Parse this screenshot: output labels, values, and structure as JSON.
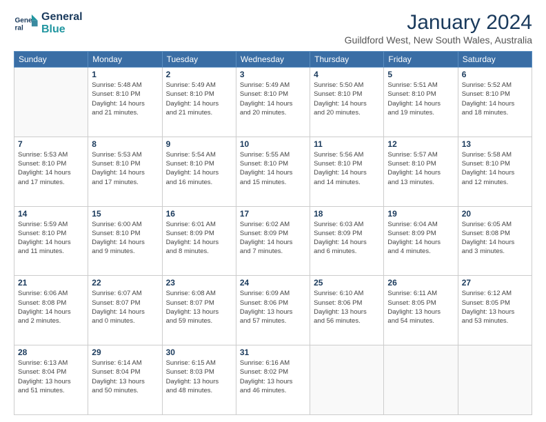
{
  "logo": {
    "line1": "General",
    "line2": "Blue"
  },
  "title": "January 2024",
  "subtitle": "Guildford West, New South Wales, Australia",
  "weekdays": [
    "Sunday",
    "Monday",
    "Tuesday",
    "Wednesday",
    "Thursday",
    "Friday",
    "Saturday"
  ],
  "weeks": [
    [
      {
        "day": "",
        "info": ""
      },
      {
        "day": "1",
        "info": "Sunrise: 5:48 AM\nSunset: 8:10 PM\nDaylight: 14 hours\nand 21 minutes."
      },
      {
        "day": "2",
        "info": "Sunrise: 5:49 AM\nSunset: 8:10 PM\nDaylight: 14 hours\nand 21 minutes."
      },
      {
        "day": "3",
        "info": "Sunrise: 5:49 AM\nSunset: 8:10 PM\nDaylight: 14 hours\nand 20 minutes."
      },
      {
        "day": "4",
        "info": "Sunrise: 5:50 AM\nSunset: 8:10 PM\nDaylight: 14 hours\nand 20 minutes."
      },
      {
        "day": "5",
        "info": "Sunrise: 5:51 AM\nSunset: 8:10 PM\nDaylight: 14 hours\nand 19 minutes."
      },
      {
        "day": "6",
        "info": "Sunrise: 5:52 AM\nSunset: 8:10 PM\nDaylight: 14 hours\nand 18 minutes."
      }
    ],
    [
      {
        "day": "7",
        "info": "Sunrise: 5:53 AM\nSunset: 8:10 PM\nDaylight: 14 hours\nand 17 minutes."
      },
      {
        "day": "8",
        "info": "Sunrise: 5:53 AM\nSunset: 8:10 PM\nDaylight: 14 hours\nand 17 minutes."
      },
      {
        "day": "9",
        "info": "Sunrise: 5:54 AM\nSunset: 8:10 PM\nDaylight: 14 hours\nand 16 minutes."
      },
      {
        "day": "10",
        "info": "Sunrise: 5:55 AM\nSunset: 8:10 PM\nDaylight: 14 hours\nand 15 minutes."
      },
      {
        "day": "11",
        "info": "Sunrise: 5:56 AM\nSunset: 8:10 PM\nDaylight: 14 hours\nand 14 minutes."
      },
      {
        "day": "12",
        "info": "Sunrise: 5:57 AM\nSunset: 8:10 PM\nDaylight: 14 hours\nand 13 minutes."
      },
      {
        "day": "13",
        "info": "Sunrise: 5:58 AM\nSunset: 8:10 PM\nDaylight: 14 hours\nand 12 minutes."
      }
    ],
    [
      {
        "day": "14",
        "info": "Sunrise: 5:59 AM\nSunset: 8:10 PM\nDaylight: 14 hours\nand 11 minutes."
      },
      {
        "day": "15",
        "info": "Sunrise: 6:00 AM\nSunset: 8:10 PM\nDaylight: 14 hours\nand 9 minutes."
      },
      {
        "day": "16",
        "info": "Sunrise: 6:01 AM\nSunset: 8:09 PM\nDaylight: 14 hours\nand 8 minutes."
      },
      {
        "day": "17",
        "info": "Sunrise: 6:02 AM\nSunset: 8:09 PM\nDaylight: 14 hours\nand 7 minutes."
      },
      {
        "day": "18",
        "info": "Sunrise: 6:03 AM\nSunset: 8:09 PM\nDaylight: 14 hours\nand 6 minutes."
      },
      {
        "day": "19",
        "info": "Sunrise: 6:04 AM\nSunset: 8:09 PM\nDaylight: 14 hours\nand 4 minutes."
      },
      {
        "day": "20",
        "info": "Sunrise: 6:05 AM\nSunset: 8:08 PM\nDaylight: 14 hours\nand 3 minutes."
      }
    ],
    [
      {
        "day": "21",
        "info": "Sunrise: 6:06 AM\nSunset: 8:08 PM\nDaylight: 14 hours\nand 2 minutes."
      },
      {
        "day": "22",
        "info": "Sunrise: 6:07 AM\nSunset: 8:07 PM\nDaylight: 14 hours\nand 0 minutes."
      },
      {
        "day": "23",
        "info": "Sunrise: 6:08 AM\nSunset: 8:07 PM\nDaylight: 13 hours\nand 59 minutes."
      },
      {
        "day": "24",
        "info": "Sunrise: 6:09 AM\nSunset: 8:06 PM\nDaylight: 13 hours\nand 57 minutes."
      },
      {
        "day": "25",
        "info": "Sunrise: 6:10 AM\nSunset: 8:06 PM\nDaylight: 13 hours\nand 56 minutes."
      },
      {
        "day": "26",
        "info": "Sunrise: 6:11 AM\nSunset: 8:05 PM\nDaylight: 13 hours\nand 54 minutes."
      },
      {
        "day": "27",
        "info": "Sunrise: 6:12 AM\nSunset: 8:05 PM\nDaylight: 13 hours\nand 53 minutes."
      }
    ],
    [
      {
        "day": "28",
        "info": "Sunrise: 6:13 AM\nSunset: 8:04 PM\nDaylight: 13 hours\nand 51 minutes."
      },
      {
        "day": "29",
        "info": "Sunrise: 6:14 AM\nSunset: 8:04 PM\nDaylight: 13 hours\nand 50 minutes."
      },
      {
        "day": "30",
        "info": "Sunrise: 6:15 AM\nSunset: 8:03 PM\nDaylight: 13 hours\nand 48 minutes."
      },
      {
        "day": "31",
        "info": "Sunrise: 6:16 AM\nSunset: 8:02 PM\nDaylight: 13 hours\nand 46 minutes."
      },
      {
        "day": "",
        "info": ""
      },
      {
        "day": "",
        "info": ""
      },
      {
        "day": "",
        "info": ""
      }
    ]
  ]
}
